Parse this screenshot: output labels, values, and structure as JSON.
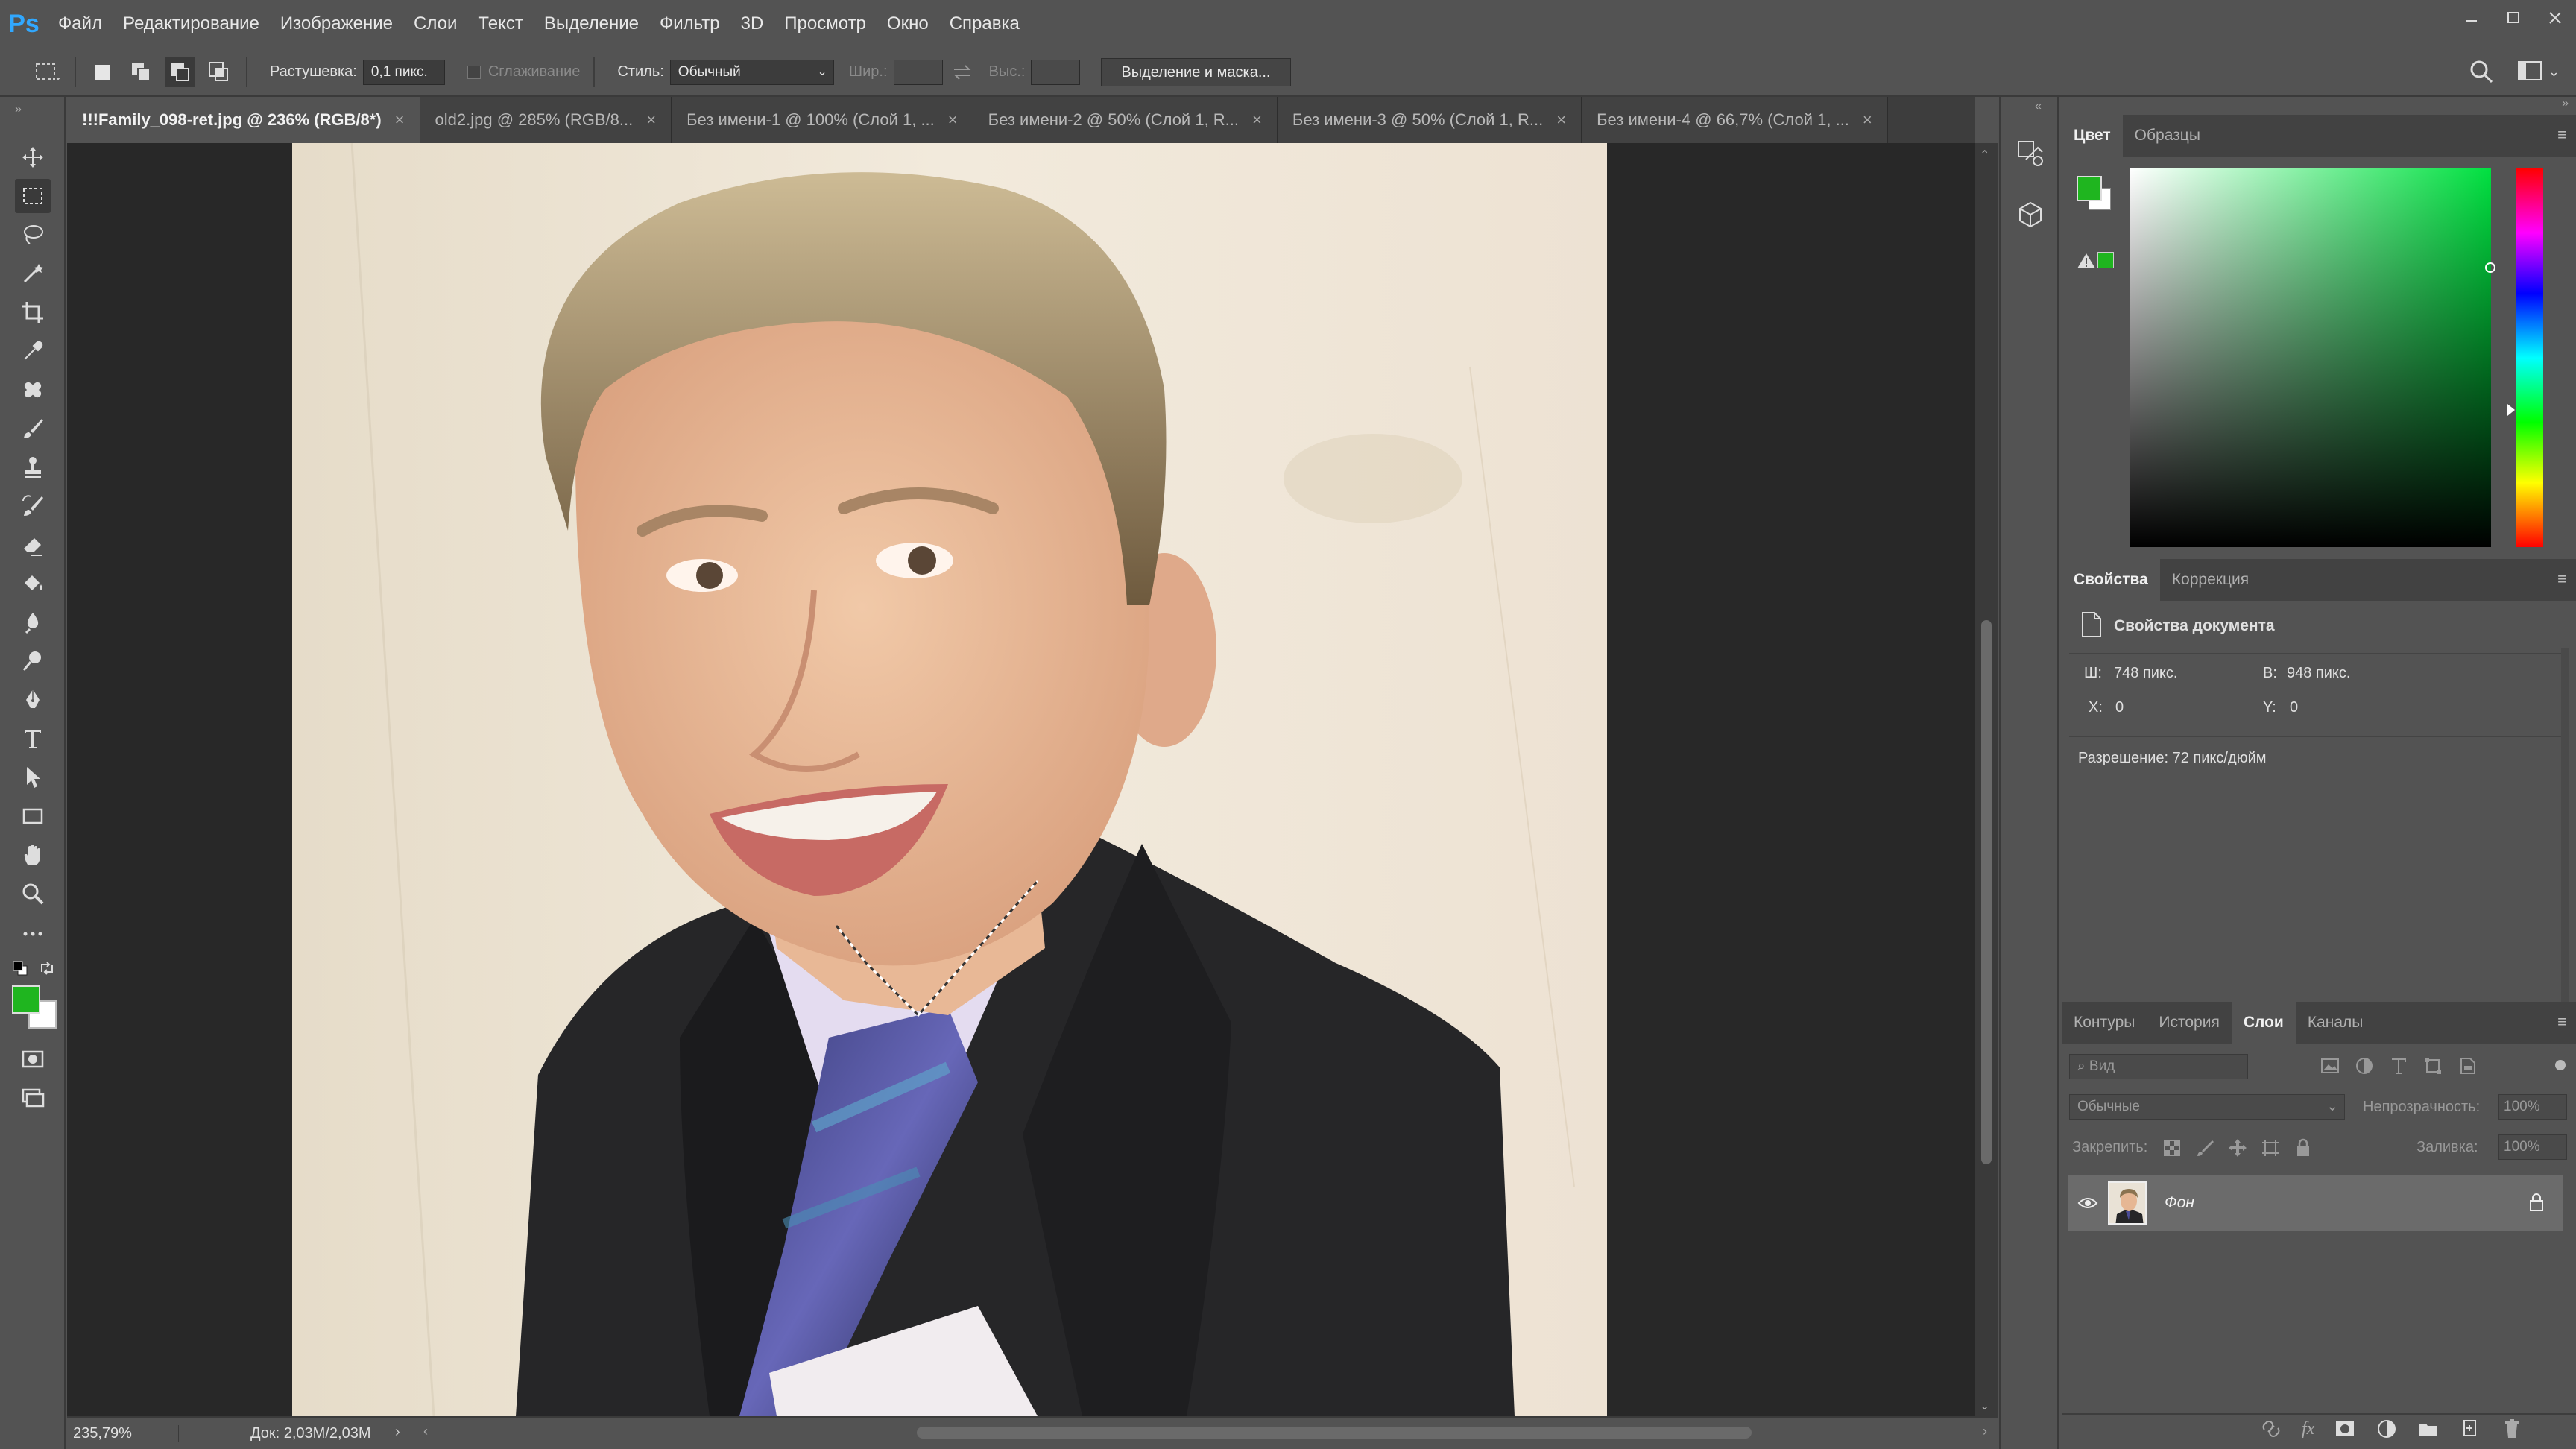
{
  "app": {
    "logo": "Ps"
  },
  "menu": [
    "Файл",
    "Редактирование",
    "Изображение",
    "Слои",
    "Текст",
    "Выделение",
    "Фильтр",
    "3D",
    "Просмотр",
    "Окно",
    "Справка"
  ],
  "options": {
    "feather_label": "Растушевка:",
    "feather_value": "0,1 пикс.",
    "antialias_label": "Сглаживание",
    "style_label": "Стиль:",
    "style_value": "Обычный",
    "width_label": "Шир.:",
    "height_label": "Выс.:",
    "select_mask_button": "Выделение и маска..."
  },
  "tabs": [
    {
      "label": "!!!Family_098-ret.jpg @ 236% (RGB/8*)",
      "close": "×"
    },
    {
      "label": "old2.jpg @ 285% (RGB/8...",
      "close": "×"
    },
    {
      "label": "Без имени-1 @ 100% (Слой 1, ...",
      "close": "×"
    },
    {
      "label": "Без имени-2 @ 50% (Слой 1, R...",
      "close": "×"
    },
    {
      "label": "Без имени-3 @ 50% (Слой 1, R...",
      "close": "×"
    },
    {
      "label": "Без имени-4 @ 66,7% (Слой 1, ...",
      "close": "×"
    }
  ],
  "status": {
    "zoom": "235,79%",
    "doc": "Док: 2,03M/2,03M",
    "arrow": "›"
  },
  "colors": {
    "foreground": "#1fb51f",
    "background": "#ffffff",
    "accent": "#31a8ff"
  },
  "color_panel": {
    "tab_color": "Цвет",
    "tab_swatches": "Образцы"
  },
  "properties_panel": {
    "tab_properties": "Свойства",
    "tab_correction": "Коррекция",
    "title": "Свойства документа",
    "w_label": "Ш:",
    "w_value": "748 пикс.",
    "h_label": "В:",
    "h_value": "948 пикс.",
    "x_label": "X:",
    "x_value": "0",
    "y_label": "Y:",
    "y_value": "0",
    "resolution": "Разрешение: 72 пикс/дюйм"
  },
  "layers_panel": {
    "tab_paths": "Контуры",
    "tab_history": "История",
    "tab_layers": "Слои",
    "tab_channels": "Каналы",
    "filter_placeholder": "Вид",
    "blend_mode": "Обычные",
    "opacity_label": "Непрозрачность:",
    "opacity_value": "100%",
    "lock_label": "Закрепить:",
    "fill_label": "Заливка:",
    "fill_value": "100%",
    "layer_name": "Фон"
  }
}
